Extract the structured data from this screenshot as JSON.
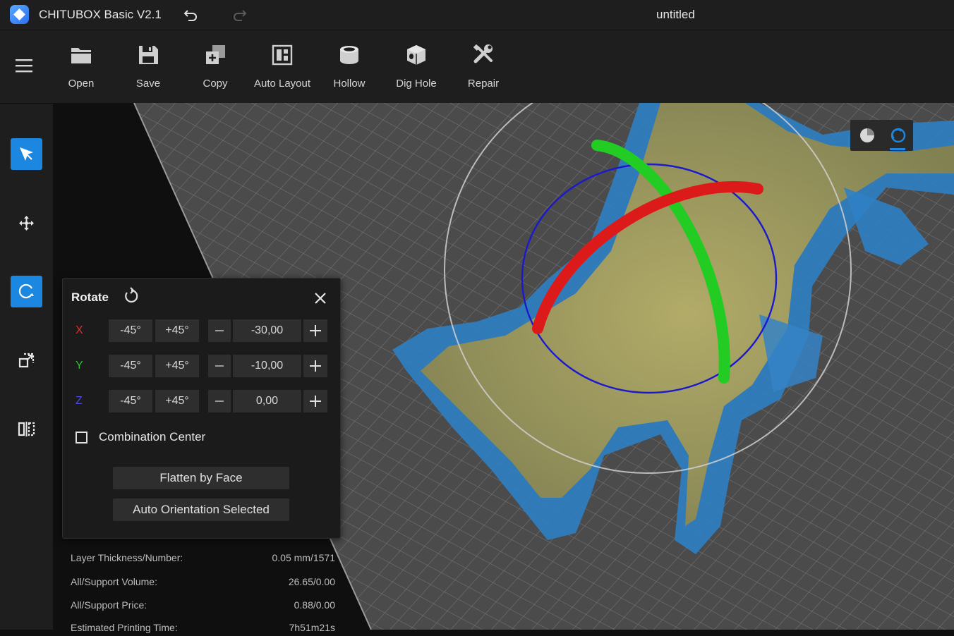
{
  "titlebar": {
    "app_name": "CHITUBOX Basic V2.1",
    "document_title": "untitled"
  },
  "toolbar": {
    "items": [
      {
        "label": "Open",
        "icon": "folder-icon"
      },
      {
        "label": "Save",
        "icon": "floppy-disk-icon"
      },
      {
        "label": "Copy",
        "icon": "copy-icon"
      },
      {
        "label": "Auto Layout",
        "icon": "auto-layout-icon"
      },
      {
        "label": "Hollow",
        "icon": "hollow-cylinder-icon"
      },
      {
        "label": "Dig Hole",
        "icon": "dig-hole-cube-icon"
      },
      {
        "label": "Repair",
        "icon": "wrench-screwdriver-icon"
      }
    ]
  },
  "sidebar": {
    "items": [
      {
        "icon": "select-cursor-icon",
        "active": true
      },
      {
        "icon": "move-arrows-icon",
        "active": false
      },
      {
        "icon": "rotate-icon",
        "active": true
      },
      {
        "icon": "scale-icon",
        "active": false
      },
      {
        "icon": "mirror-icon",
        "active": false
      }
    ]
  },
  "rotate_panel": {
    "title": "Rotate",
    "axes": [
      {
        "axis": "X",
        "color": "#e03030",
        "minus45": "-45°",
        "plus45": "+45°",
        "value": "-30,00"
      },
      {
        "axis": "Y",
        "color": "#2fbf2f",
        "minus45": "-45°",
        "plus45": "+45°",
        "value": "-10,00"
      },
      {
        "axis": "Z",
        "color": "#4a4adf",
        "minus45": "-45°",
        "plus45": "+45°",
        "value": "0,00"
      }
    ],
    "combination_center": {
      "label": "Combination Center",
      "checked": false
    },
    "flatten_label": "Flatten by Face",
    "auto_orient_label": "Auto Orientation Selected"
  },
  "stats": [
    {
      "key": "Layer Thickness/Number:",
      "value": "0.05 mm/1571"
    },
    {
      "key": "All/Support Volume:",
      "value": "26.65/0.00"
    },
    {
      "key": "All/Support Price:",
      "value": "0.88/0.00"
    },
    {
      "key": "Estimated Printing Time:",
      "value": "7h51m21s"
    }
  ],
  "colors": {
    "accent": "#1c87e0",
    "x_axis": "#e03030",
    "y_axis": "#22cc22",
    "z_axis": "#1a1acc"
  }
}
